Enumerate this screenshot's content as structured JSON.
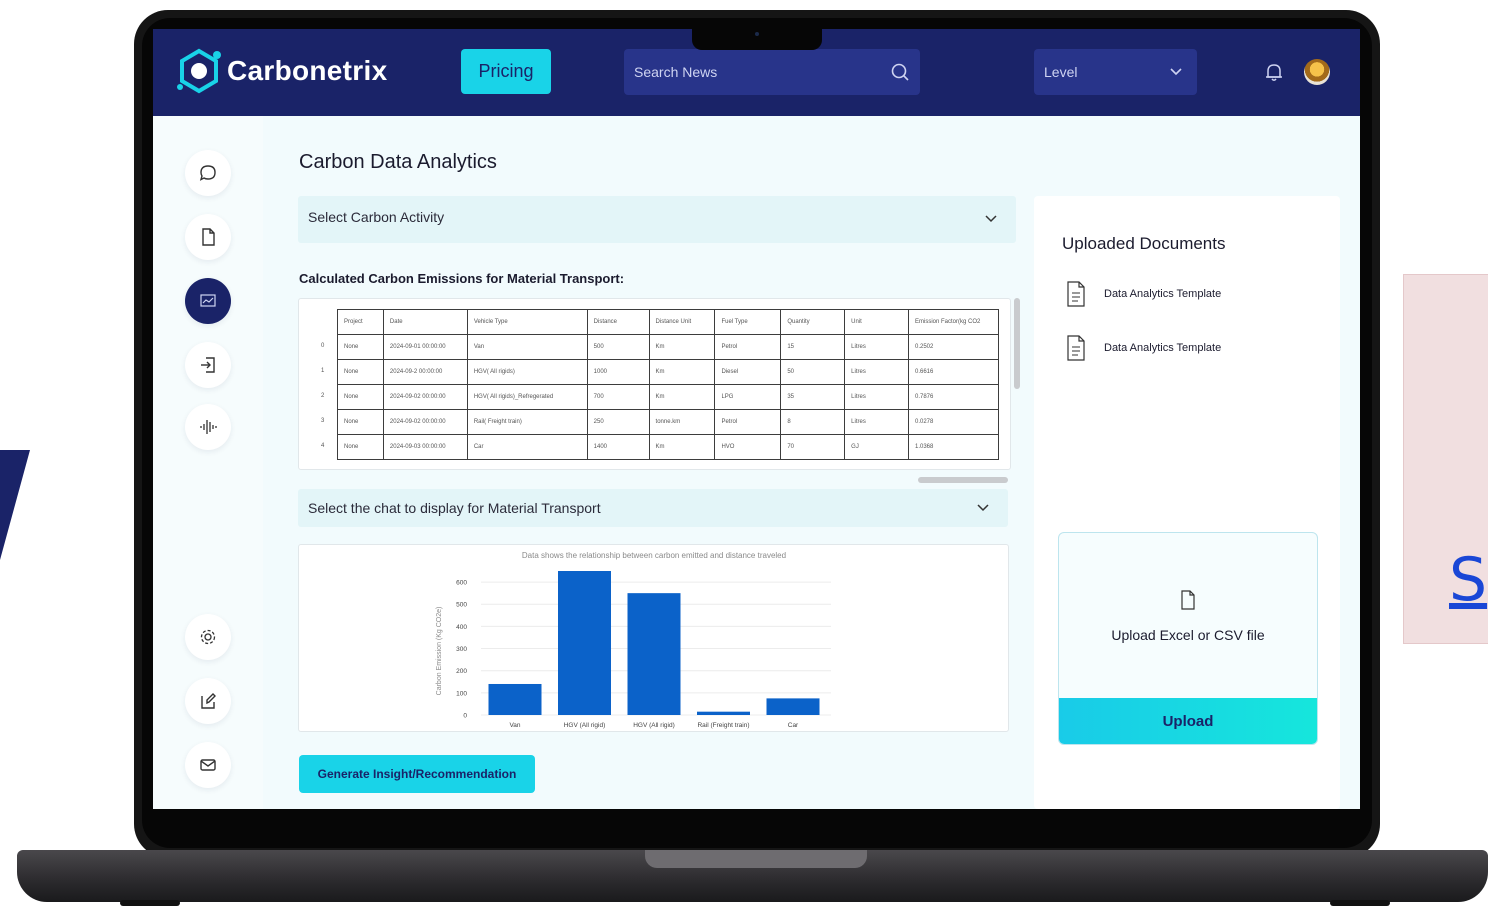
{
  "app": {
    "brand": "Carbonetrix"
  },
  "header": {
    "pricing_label": "Pricing",
    "search_placeholder": "Search News",
    "level_label": "Level"
  },
  "sidebar": {
    "items": [
      {
        "icon": "chat-icon"
      },
      {
        "icon": "document-icon"
      },
      {
        "icon": "analytics-icon",
        "active": true
      },
      {
        "icon": "import-icon"
      },
      {
        "icon": "audio-wave-icon"
      },
      {
        "icon": "gear-icon"
      },
      {
        "icon": "edit-icon"
      },
      {
        "icon": "mail-icon"
      }
    ]
  },
  "main": {
    "title": "Carbon Data Analytics",
    "activity_select": "Select Carbon Activity",
    "section_label": "Calculated Carbon Emissions for Material Transport:",
    "chart_select": "Select the chat to display for Material Transport",
    "generate_button": "Generate Insight/Recommendation"
  },
  "table": {
    "headers": [
      "Project",
      "Date",
      "Vehicle Type",
      "Distance",
      "Distance Unit",
      "Fuel Type",
      "Quantity",
      "Unit",
      "Emission Factor(kg CO2"
    ],
    "rows": [
      {
        "idx": "0",
        "cells": [
          "None",
          "2024-09-01 00:00:00",
          "Van",
          "500",
          "Km",
          "Petrol",
          "15",
          "Litres",
          "0.2502"
        ]
      },
      {
        "idx": "1",
        "cells": [
          "None",
          "2024-09-2 00:00:00",
          "HGV( All rigids)",
          "1000",
          "Km",
          "Diesel",
          "50",
          "Litres",
          "0.6616"
        ]
      },
      {
        "idx": "2",
        "cells": [
          "None",
          "2024-09-02 00:00:00",
          "HGV( All rigids)_Refregerated",
          "700",
          "Km",
          "LPG",
          "35",
          "Litres",
          "0.7876"
        ]
      },
      {
        "idx": "3",
        "cells": [
          "None",
          "2024-09-02 00:00:00",
          "Rail( Freight train)",
          "250",
          "tonne.km",
          "Petrol",
          "8",
          "Litres",
          "0.0278"
        ]
      },
      {
        "idx": "4",
        "cells": [
          "None",
          "2024-09-03 00:00:00",
          "Car",
          "1400",
          "Km",
          "HVO",
          "70",
          "GJ",
          "1.0368"
        ]
      }
    ]
  },
  "chart_data": {
    "type": "bar",
    "title": "Data shows the relationship between carbon emitted and distance traveled",
    "xlabel": "",
    "ylabel": "Carbon Emission (Kg CO2e)",
    "categories": [
      "Van",
      "HGV (All rigid)",
      "HGV (All rigid)",
      "Rail (Freight train)",
      "Car"
    ],
    "values": [
      140,
      650,
      550,
      15,
      75
    ],
    "yticks": [
      0,
      100,
      200,
      300,
      400,
      500,
      600
    ],
    "ylim": [
      0,
      650
    ],
    "grid": true,
    "color": "#0b62c9"
  },
  "docs": {
    "title": "Uploaded Documents",
    "items": [
      "Data Analytics Template",
      "Data Analytics Template"
    ],
    "upload_text": "Upload Excel or CSV file",
    "upload_button": "Upload"
  },
  "background": {
    "side_letter": "S"
  },
  "colors": {
    "navy": "#1a2368",
    "accent": "#19d3e8",
    "bar": "#0b62c9"
  }
}
